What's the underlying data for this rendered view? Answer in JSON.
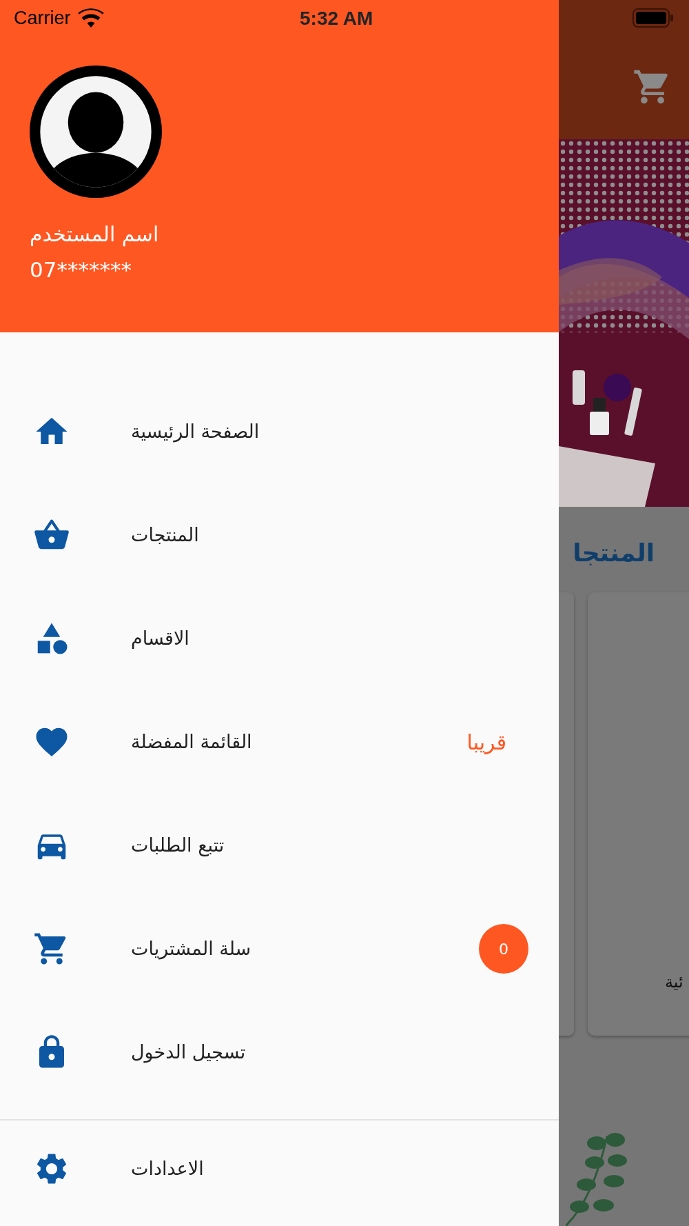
{
  "status_bar": {
    "carrier": "Carrier",
    "time": "5:32 AM"
  },
  "drawer": {
    "header": {
      "user_name": "اسم المستخدم",
      "phone": "07*******"
    },
    "menu_items": [
      {
        "label": "الصفحة الرئيسية"
      },
      {
        "label": "المنتجات"
      },
      {
        "label": "الاقسام"
      },
      {
        "label": "القائمة المفضلة",
        "tag": "قريبا"
      },
      {
        "label": "تتبع الطلبات"
      },
      {
        "label": "سلة المشتريات",
        "badge": "0"
      },
      {
        "label": "تسجيل الدخول"
      }
    ],
    "footer_items": [
      {
        "label": "الاعدادات"
      }
    ]
  },
  "background_screen": {
    "section_title": "المنتجا",
    "card_text": "ئية"
  }
}
